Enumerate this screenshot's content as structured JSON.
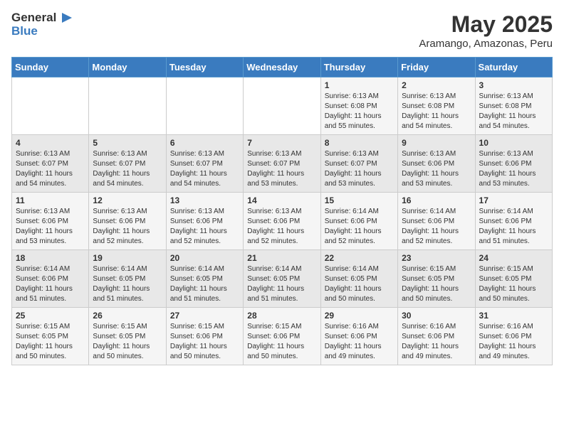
{
  "header": {
    "logo_general": "General",
    "logo_blue": "Blue",
    "title": "May 2025",
    "subtitle": "Aramango, Amazonas, Peru"
  },
  "calendar": {
    "days_of_week": [
      "Sunday",
      "Monday",
      "Tuesday",
      "Wednesday",
      "Thursday",
      "Friday",
      "Saturday"
    ],
    "weeks": [
      [
        {
          "day": "",
          "sunrise": "",
          "sunset": "",
          "daylight": ""
        },
        {
          "day": "",
          "sunrise": "",
          "sunset": "",
          "daylight": ""
        },
        {
          "day": "",
          "sunrise": "",
          "sunset": "",
          "daylight": ""
        },
        {
          "day": "",
          "sunrise": "",
          "sunset": "",
          "daylight": ""
        },
        {
          "day": "1",
          "sunrise": "Sunrise: 6:13 AM",
          "sunset": "Sunset: 6:08 PM",
          "daylight": "Daylight: 11 hours and 55 minutes."
        },
        {
          "day": "2",
          "sunrise": "Sunrise: 6:13 AM",
          "sunset": "Sunset: 6:08 PM",
          "daylight": "Daylight: 11 hours and 54 minutes."
        },
        {
          "day": "3",
          "sunrise": "Sunrise: 6:13 AM",
          "sunset": "Sunset: 6:08 PM",
          "daylight": "Daylight: 11 hours and 54 minutes."
        }
      ],
      [
        {
          "day": "4",
          "sunrise": "Sunrise: 6:13 AM",
          "sunset": "Sunset: 6:07 PM",
          "daylight": "Daylight: 11 hours and 54 minutes."
        },
        {
          "day": "5",
          "sunrise": "Sunrise: 6:13 AM",
          "sunset": "Sunset: 6:07 PM",
          "daylight": "Daylight: 11 hours and 54 minutes."
        },
        {
          "day": "6",
          "sunrise": "Sunrise: 6:13 AM",
          "sunset": "Sunset: 6:07 PM",
          "daylight": "Daylight: 11 hours and 54 minutes."
        },
        {
          "day": "7",
          "sunrise": "Sunrise: 6:13 AM",
          "sunset": "Sunset: 6:07 PM",
          "daylight": "Daylight: 11 hours and 53 minutes."
        },
        {
          "day": "8",
          "sunrise": "Sunrise: 6:13 AM",
          "sunset": "Sunset: 6:07 PM",
          "daylight": "Daylight: 11 hours and 53 minutes."
        },
        {
          "day": "9",
          "sunrise": "Sunrise: 6:13 AM",
          "sunset": "Sunset: 6:06 PM",
          "daylight": "Daylight: 11 hours and 53 minutes."
        },
        {
          "day": "10",
          "sunrise": "Sunrise: 6:13 AM",
          "sunset": "Sunset: 6:06 PM",
          "daylight": "Daylight: 11 hours and 53 minutes."
        }
      ],
      [
        {
          "day": "11",
          "sunrise": "Sunrise: 6:13 AM",
          "sunset": "Sunset: 6:06 PM",
          "daylight": "Daylight: 11 hours and 53 minutes."
        },
        {
          "day": "12",
          "sunrise": "Sunrise: 6:13 AM",
          "sunset": "Sunset: 6:06 PM",
          "daylight": "Daylight: 11 hours and 52 minutes."
        },
        {
          "day": "13",
          "sunrise": "Sunrise: 6:13 AM",
          "sunset": "Sunset: 6:06 PM",
          "daylight": "Daylight: 11 hours and 52 minutes."
        },
        {
          "day": "14",
          "sunrise": "Sunrise: 6:13 AM",
          "sunset": "Sunset: 6:06 PM",
          "daylight": "Daylight: 11 hours and 52 minutes."
        },
        {
          "day": "15",
          "sunrise": "Sunrise: 6:14 AM",
          "sunset": "Sunset: 6:06 PM",
          "daylight": "Daylight: 11 hours and 52 minutes."
        },
        {
          "day": "16",
          "sunrise": "Sunrise: 6:14 AM",
          "sunset": "Sunset: 6:06 PM",
          "daylight": "Daylight: 11 hours and 52 minutes."
        },
        {
          "day": "17",
          "sunrise": "Sunrise: 6:14 AM",
          "sunset": "Sunset: 6:06 PM",
          "daylight": "Daylight: 11 hours and 51 minutes."
        }
      ],
      [
        {
          "day": "18",
          "sunrise": "Sunrise: 6:14 AM",
          "sunset": "Sunset: 6:06 PM",
          "daylight": "Daylight: 11 hours and 51 minutes."
        },
        {
          "day": "19",
          "sunrise": "Sunrise: 6:14 AM",
          "sunset": "Sunset: 6:05 PM",
          "daylight": "Daylight: 11 hours and 51 minutes."
        },
        {
          "day": "20",
          "sunrise": "Sunrise: 6:14 AM",
          "sunset": "Sunset: 6:05 PM",
          "daylight": "Daylight: 11 hours and 51 minutes."
        },
        {
          "day": "21",
          "sunrise": "Sunrise: 6:14 AM",
          "sunset": "Sunset: 6:05 PM",
          "daylight": "Daylight: 11 hours and 51 minutes."
        },
        {
          "day": "22",
          "sunrise": "Sunrise: 6:14 AM",
          "sunset": "Sunset: 6:05 PM",
          "daylight": "Daylight: 11 hours and 50 minutes."
        },
        {
          "day": "23",
          "sunrise": "Sunrise: 6:15 AM",
          "sunset": "Sunset: 6:05 PM",
          "daylight": "Daylight: 11 hours and 50 minutes."
        },
        {
          "day": "24",
          "sunrise": "Sunrise: 6:15 AM",
          "sunset": "Sunset: 6:05 PM",
          "daylight": "Daylight: 11 hours and 50 minutes."
        }
      ],
      [
        {
          "day": "25",
          "sunrise": "Sunrise: 6:15 AM",
          "sunset": "Sunset: 6:05 PM",
          "daylight": "Daylight: 11 hours and 50 minutes."
        },
        {
          "day": "26",
          "sunrise": "Sunrise: 6:15 AM",
          "sunset": "Sunset: 6:05 PM",
          "daylight": "Daylight: 11 hours and 50 minutes."
        },
        {
          "day": "27",
          "sunrise": "Sunrise: 6:15 AM",
          "sunset": "Sunset: 6:06 PM",
          "daylight": "Daylight: 11 hours and 50 minutes."
        },
        {
          "day": "28",
          "sunrise": "Sunrise: 6:15 AM",
          "sunset": "Sunset: 6:06 PM",
          "daylight": "Daylight: 11 hours and 50 minutes."
        },
        {
          "day": "29",
          "sunrise": "Sunrise: 6:16 AM",
          "sunset": "Sunset: 6:06 PM",
          "daylight": "Daylight: 11 hours and 49 minutes."
        },
        {
          "day": "30",
          "sunrise": "Sunrise: 6:16 AM",
          "sunset": "Sunset: 6:06 PM",
          "daylight": "Daylight: 11 hours and 49 minutes."
        },
        {
          "day": "31",
          "sunrise": "Sunrise: 6:16 AM",
          "sunset": "Sunset: 6:06 PM",
          "daylight": "Daylight: 11 hours and 49 minutes."
        }
      ]
    ]
  }
}
